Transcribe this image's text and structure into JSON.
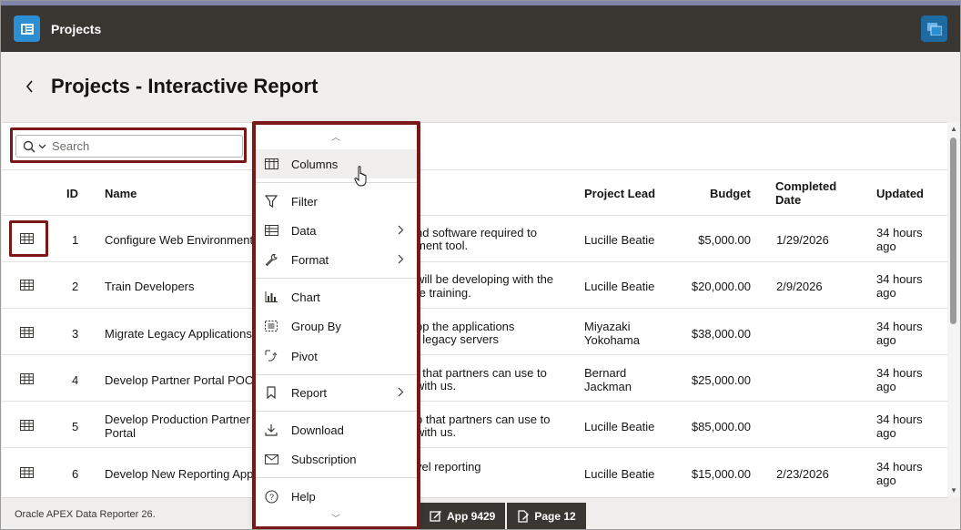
{
  "app": {
    "title": "Projects",
    "logo_icon": "report-icon",
    "brand_color": "#2d8fd3",
    "header_color": "#3a3632"
  },
  "page": {
    "title": "Projects - Interactive Report"
  },
  "search": {
    "placeholder": "Search",
    "value": ""
  },
  "table": {
    "headers": {
      "id": "ID",
      "name": "Name",
      "project_lead": "Project Lead",
      "budget": "Budget",
      "completed_date": "Completed Date",
      "updated": "Updated"
    },
    "rows": [
      {
        "id": "1",
        "name": "Configure Web Environment",
        "desc1": "nd software required to",
        "desc2": "ment tool.",
        "lead": "Lucille Beatie",
        "budget": "$5,000.00",
        "completed": "1/29/2026",
        "updated": "34 hours ago"
      },
      {
        "id": "2",
        "name": "Train Developers",
        "desc1": "will be developing with the",
        "desc2": "te training.",
        "lead": "Lucille Beatie",
        "budget": "$20,000.00",
        "completed": "2/9/2026",
        "updated": "34 hours ago"
      },
      {
        "id": "3",
        "name": "Migrate Legacy Applications",
        "desc1": "op the applications",
        "desc2": "f legacy servers",
        "lead": "Miyazaki Yokohama",
        "budget": "$38,000.00",
        "completed": "",
        "updated": "34 hours ago"
      },
      {
        "id": "4",
        "name": "Develop Partner Portal POC",
        "desc1": "t that partners can use to",
        "desc2": "with us.",
        "lead": "Bernard Jackman",
        "budget": "$25,000.00",
        "completed": "",
        "updated": "34 hours ago"
      },
      {
        "id": "5",
        "name": "Develop Production Partner Portal",
        "desc1": "p that partners can use to",
        "desc2": "with us.",
        "lead": "Lucille Beatie",
        "budget": "$85,000.00",
        "completed": "",
        "updated": "34 hours ago"
      },
      {
        "id": "6",
        "name": "Develop New Reporting App",
        "desc1": "vel reporting",
        "desc2": "",
        "lead": "Lucille Beatie",
        "budget": "$15,000.00",
        "completed": "2/23/2026",
        "updated": "34 hours ago"
      }
    ]
  },
  "actions_menu": {
    "items": [
      {
        "label": "Columns",
        "icon": "columns-icon"
      },
      {
        "label": "Filter",
        "icon": "filter-icon"
      },
      {
        "label": "Data",
        "icon": "table-icon"
      },
      {
        "label": "Format",
        "icon": "wrench-icon"
      },
      {
        "label": "Chart",
        "icon": "bar-chart-icon"
      },
      {
        "label": "Group By",
        "icon": "group-by-icon"
      },
      {
        "label": "Pivot",
        "icon": "pivot-icon"
      },
      {
        "label": "Report",
        "icon": "bookmark-icon"
      },
      {
        "label": "Download",
        "icon": "download-icon"
      },
      {
        "label": "Subscription",
        "icon": "mail-icon"
      },
      {
        "label": "Help",
        "icon": "help-icon"
      }
    ]
  },
  "footer": {
    "text": "Oracle APEX Data Reporter 26."
  },
  "developer_toolbar": {
    "app": "App 9429",
    "page": "Page 12"
  }
}
